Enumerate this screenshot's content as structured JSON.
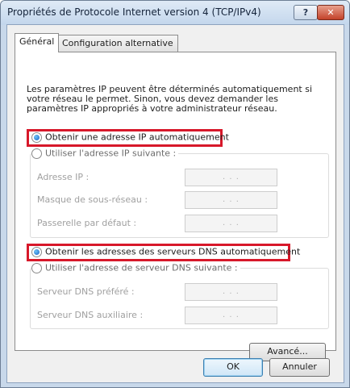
{
  "window": {
    "title": "Propriétés de Protocole Internet version 4 (TCP/IPv4)",
    "help_label": "?",
    "close_label": "✕"
  },
  "tabs": [
    {
      "label": "Général",
      "active": true
    },
    {
      "label": "Configuration alternative",
      "active": false
    }
  ],
  "description": "Les paramètres IP peuvent être déterminés automatiquement si votre réseau le permet. Sinon, vous devez demander les paramètres IP appropriés à votre administrateur réseau.",
  "ip_section": {
    "auto_label": "Obtenir une adresse IP automatiquement",
    "auto_checked": true,
    "manual_label": "Utiliser l'adresse IP suivante :",
    "fields": [
      {
        "label": "Adresse IP :",
        "value": ". . ."
      },
      {
        "label": "Masque de sous-réseau :",
        "value": ". . ."
      },
      {
        "label": "Passerelle par défaut :",
        "value": ". . ."
      }
    ]
  },
  "dns_section": {
    "auto_label": "Obtenir les adresses des serveurs DNS automatiquement",
    "auto_checked": true,
    "manual_label": "Utiliser l'adresse de serveur DNS suivante :",
    "fields": [
      {
        "label": "Serveur DNS préféré :",
        "value": ". . ."
      },
      {
        "label": "Serveur DNS auxiliaire :",
        "value": ". . ."
      }
    ]
  },
  "buttons": {
    "advanced": "Avancé...",
    "ok": "OK",
    "cancel": "Annuler"
  },
  "colors": {
    "highlight": "#d7182a",
    "default_button_border": "#3c7fb1",
    "close_button": "#c3422a"
  }
}
